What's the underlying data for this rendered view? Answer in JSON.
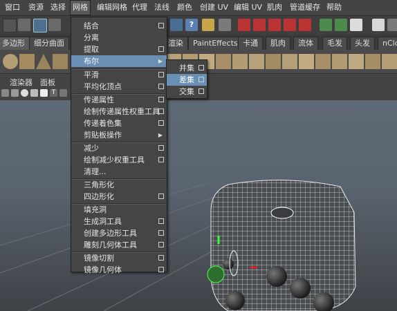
{
  "menubar": {
    "items": [
      "窗口",
      "资源",
      "选择",
      "网格",
      "编辑网格",
      "代理",
      "法线",
      "颜色",
      "创建 UV",
      "编辑 UV",
      "肌肉",
      "管道缓存",
      "帮助"
    ],
    "active": "网格"
  },
  "shelf": {
    "tabs": [
      "多边形",
      "细分曲面",
      "渲染",
      "PaintEffects",
      "卡通",
      "肌肉",
      "流体",
      "毛发",
      "头发",
      "nCloth"
    ]
  },
  "panel": {
    "menu": [
      "渲染器",
      "面板"
    ]
  },
  "mesh_menu": {
    "items": [
      {
        "label": "结合",
        "option": true
      },
      {
        "label": "分离",
        "option": false
      },
      {
        "label": "提取",
        "option": true
      },
      {
        "label": "布尔",
        "submenu": true
      },
      {
        "label": "平滑",
        "option": true
      },
      {
        "label": "平均化顶点",
        "option": true
      },
      {
        "label": "传递属性",
        "option": true
      },
      {
        "label": "绘制传递属性权重工具",
        "option": true
      },
      {
        "label": "传递着色集",
        "option": true
      },
      {
        "label": "剪贴板操作",
        "submenu": true
      },
      {
        "label": "减少",
        "option": true
      },
      {
        "label": "绘制减少权重工具",
        "option": true
      },
      {
        "label": "清理...",
        "option": false
      },
      {
        "label": "三角形化",
        "option": false
      },
      {
        "label": "四边形化",
        "option": true
      },
      {
        "label": "填充洞",
        "option": false
      },
      {
        "label": "生成洞工具",
        "option": true
      },
      {
        "label": "创建多边形工具",
        "option": true
      },
      {
        "label": "雕刻几何体工具",
        "option": true
      },
      {
        "label": "镜像切割",
        "option": true
      },
      {
        "label": "镜像几何体",
        "option": true
      }
    ]
  },
  "boolean_menu": {
    "items": [
      {
        "label": "并集",
        "option": true
      },
      {
        "label": "差集",
        "option": true
      },
      {
        "label": "交集",
        "option": true
      }
    ]
  },
  "colors": {
    "highlight": "#6a8fb5",
    "viewport_top": "#5e6a76",
    "menu_bg": "#454545"
  }
}
